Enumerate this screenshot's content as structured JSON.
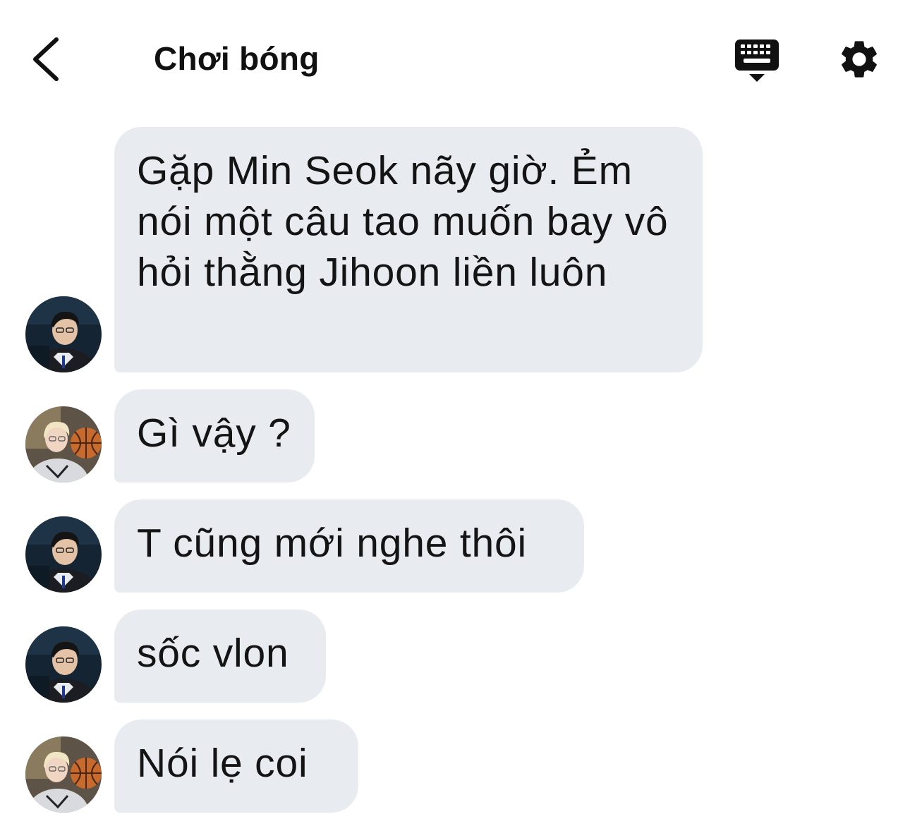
{
  "header": {
    "title": "Chơi bóng",
    "back_icon": "chevron-left-icon",
    "keyboard_icon": "keyboard-hide-icon",
    "settings_icon": "gear-icon"
  },
  "colors": {
    "bubble_bg": "#e8ecf1",
    "text": "#141414",
    "background": "#ffffff"
  },
  "messages": [
    {
      "sender": "user-a",
      "text": "Gặp Min Seok nãy giờ. Ẻm nói một câu tao muốn bay vô hỏi thằng Jihoon liền luôn"
    },
    {
      "sender": "user-b",
      "text": "Gì vậy ?"
    },
    {
      "sender": "user-a",
      "text": "T cũng mới nghe thôi"
    },
    {
      "sender": "user-a",
      "text": "sốc vlon"
    },
    {
      "sender": "user-b",
      "text": "Nói lẹ coi"
    }
  ]
}
